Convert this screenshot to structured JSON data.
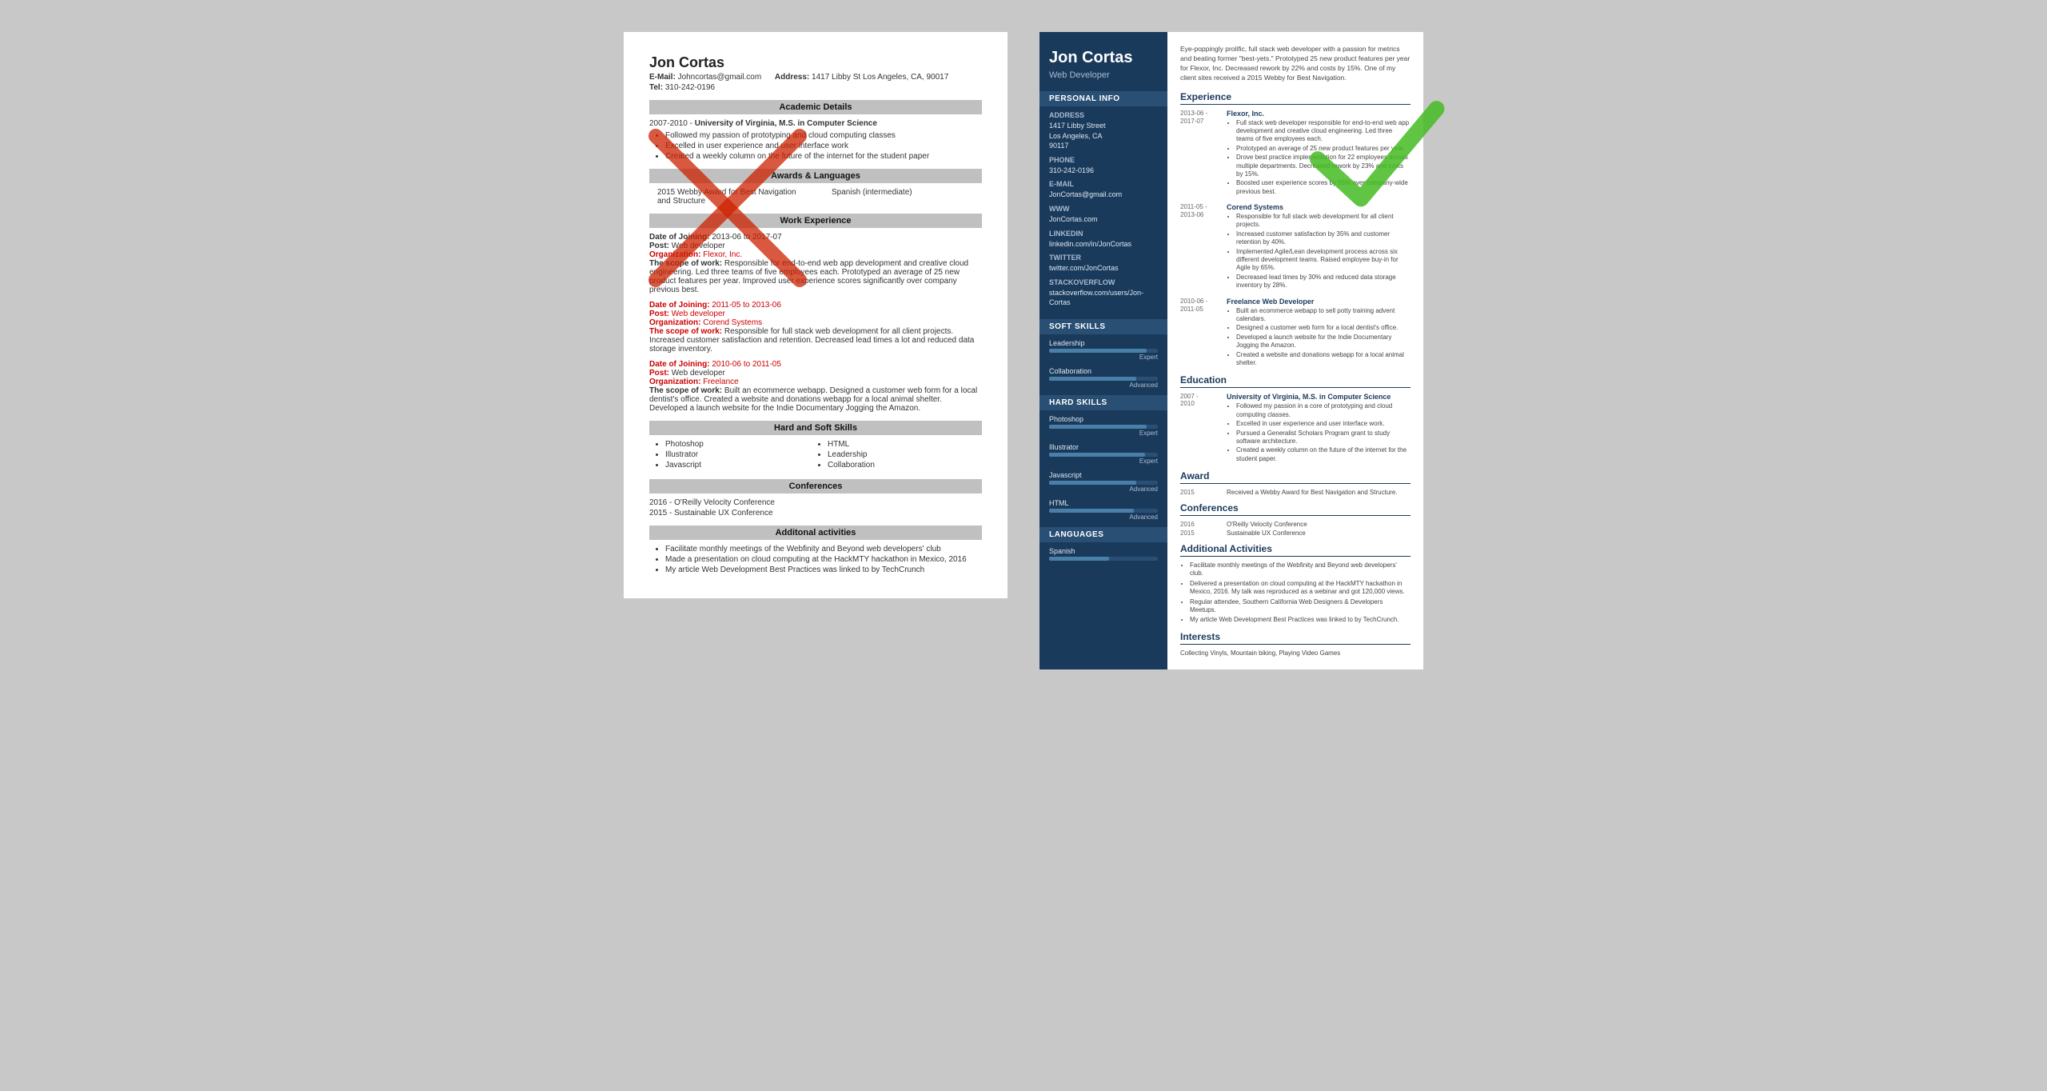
{
  "left": {
    "name": "Jon Cortas",
    "email_label": "E-Mail:",
    "email": "Johncortas@gmail.com",
    "address_label": "Address:",
    "address": "1417 Libby St Los Angeles, CA, 90017",
    "tel_label": "Tel:",
    "tel": "310-242-0196",
    "sections": {
      "academic": "Academic Details",
      "awards": "Awards & Languages",
      "work": "Work Experience",
      "skills": "Hard and Soft Skills",
      "conferences": "Conferences",
      "activities": "Additonal activities"
    },
    "academic": {
      "years": "2007-2010 -",
      "degree": "University of Virginia, M.S. in Computer Science",
      "bullets": [
        "Followed my passion of prototyping and cloud computing classes",
        "Excelled in user experience and user interface work",
        "Created a weekly column on the future of the internet for the student paper"
      ]
    },
    "awards": {
      "left": "2015 Webby Award for Best Navigation and Structure",
      "right": "Spanish (intermediate)"
    },
    "work_entries": [
      {
        "date_label": "Date of Joining:",
        "date": "2013-06 to 2017-07",
        "post_label": "Post:",
        "post": "Web developer",
        "org_label": "Organization:",
        "org": "Flexor, Inc.",
        "scope_label": "The scope of work:",
        "scope": "Responsible for end-to-end web app development and creative cloud engineering. Led three teams of five employees each. Prototyped an average of 25 new product features per year. Improved user experience scores significantly over company previous best."
      },
      {
        "date_label": "Date of Joining:",
        "date": "2011-05 to 2013-06",
        "post_label": "Post:",
        "post": "Web developer",
        "org_label": "Organization:",
        "org": "Corend Systems",
        "scope_label": "The scope of work:",
        "scope": "Responsible for full stack web development for all client projects. Increased customer satisfaction and retention. Decreased lead times a lot and reduced data storage inventory."
      },
      {
        "date_label": "Date of Joining:",
        "date": "2010-06 to 2011-05",
        "post_label": "Post:",
        "post": "Web developer",
        "org_label": "Organization:",
        "org": "Freelance",
        "scope_label": "The scope of work:",
        "scope": "Built an ecommerce webapp. Designed a customer web form for a local dentist's office. Created a website and donations webapp for a local animal shelter. Developed a launch website for the Indie Documentary Jogging the Amazon."
      }
    ],
    "skills": [
      "Photoshop",
      "Illustrator",
      "Javascript",
      "HTML",
      "Leadership",
      "Collaboration"
    ],
    "conferences": [
      "2016 - O'Reilly Velocity Conference",
      "2015 - Sustainable UX Conference"
    ],
    "activities": [
      "Facilitate monthly meetings of the Webfinity and Beyond web developers' club",
      "Made a presentation on cloud computing at the HackMTY hackathon in Mexico, 2016",
      "My article Web Development Best Practices was linked to by TechCrunch"
    ]
  },
  "right": {
    "name": "Jon Cortas",
    "title": "Web Developer",
    "intro": "Eye-poppingly prolific, full stack web developer with a passion for metrics and beating former \"best-yets.\" Prototyped 25 new product features per year for Flexor, Inc. Decreased rework by 22% and costs by 15%. One of my client sites received a 2015 Webby for Best Navigation.",
    "personal_info_header": "Personal Info",
    "address_label": "Address",
    "address": "1417 Libby Street\nLos Angeles, CA\n90117",
    "phone_label": "Phone",
    "phone": "310-242-0196",
    "email_label": "E-mail",
    "email": "JonCortas@gmail.com",
    "www_label": "WWW",
    "www": "JonCortas.com",
    "linkedin_label": "LinkedIn",
    "linkedin": "linkedin.com/in/JonCortas",
    "twitter_label": "Twitter",
    "twitter": "twitter.com/JonCortas",
    "stackoverflow_label": "StackOverflow",
    "stackoverflow": "stackoverflow.com/users/Jon-Cortas",
    "soft_skills_header": "Soft Skills",
    "soft_skills": [
      {
        "name": "Leadership",
        "level": "Expert",
        "pct": 90
      },
      {
        "name": "Collaboration",
        "level": "Advanced",
        "pct": 80
      }
    ],
    "hard_skills_header": "Hard Skills",
    "hard_skills": [
      {
        "name": "Photoshop",
        "level": "Expert",
        "pct": 90
      },
      {
        "name": "Illustrator",
        "level": "Expert",
        "pct": 88
      },
      {
        "name": "Javascript",
        "level": "Advanced",
        "pct": 80
      },
      {
        "name": "HTML",
        "level": "Advanced",
        "pct": 78
      }
    ],
    "languages_header": "Languages",
    "languages": [
      {
        "name": "Spanish",
        "level": "",
        "pct": 55
      }
    ],
    "experience_header": "Experience",
    "experiences": [
      {
        "start": "2013-06 -",
        "end": "2017-07",
        "company": "Flexor, Inc.",
        "bullets": [
          "Full stack web developer responsible for end-to-end web app development and creative cloud engineering. Led three teams of five employees each.",
          "Prototyped an average of 25 new product features per year.",
          "Drove best practice implementation for 22 employees across multiple departments. Decreased rework by 23% and costs by 15%.",
          "Boosted user experience scores by 55% over company-wide previous best."
        ]
      },
      {
        "start": "2011-05 -",
        "end": "2013-06",
        "company": "Corend Systems",
        "bullets": [
          "Responsible for full stack web development for all client projects.",
          "Increased customer satisfaction by 35% and customer retention by 40%.",
          "Implemented Agile/Lean development process across six different development teams. Raised employee buy-in for Agile by 65%.",
          "Decreased lead times by 30% and reduced data storage inventory by 28%."
        ]
      },
      {
        "start": "2010-06 -",
        "end": "2011-05",
        "company": "Freelance Web Developer",
        "bullets": [
          "Built an ecommerce webapp to sell potty training advent calendars.",
          "Designed a customer web form for a local dentist's office.",
          "Developed a launch website for the Indie Documentary Jogging the Amazon.",
          "Created a website and donations webapp for a local animal shelter."
        ]
      }
    ],
    "education_header": "Education",
    "education": [
      {
        "start": "2007 -",
        "end": "2010",
        "school": "University of Virginia, M.S. in Computer Science",
        "bullets": [
          "Followed my passion in a core of prototyping and cloud computing classes.",
          "Excelled in user experience and user interface work.",
          "Pursued a Generalist Scholars Program grant to study software architecture.",
          "Created a weekly column on the future of the internet for the student paper."
        ]
      }
    ],
    "award_header": "Award",
    "award_year": "2015",
    "award_text": "Received a Webby Award for Best Navigation and Structure.",
    "conferences_header": "Conferences",
    "conferences": [
      {
        "year": "2016",
        "name": "O'Reilly Velocity Conference"
      },
      {
        "year": "2015",
        "name": "Sustainable UX Conference"
      }
    ],
    "activities_header": "Additional Activities",
    "activities": [
      "Facilitate monthly meetings of the Webfinity and Beyond web developers' club.",
      "Delivered a presentation on cloud computing at the HackMTY hackathon in Mexico, 2016. My talk was reproduced as a webinar and got 120,000 views.",
      "Regular attendee, Southern California Web Designers & Developers Meetups.",
      "My article Web Development Best Practices was linked to by TechCrunch."
    ],
    "interests_header": "Interests",
    "interests": "Collecting Vinyls, Mountain biking, Playing Video Games"
  }
}
